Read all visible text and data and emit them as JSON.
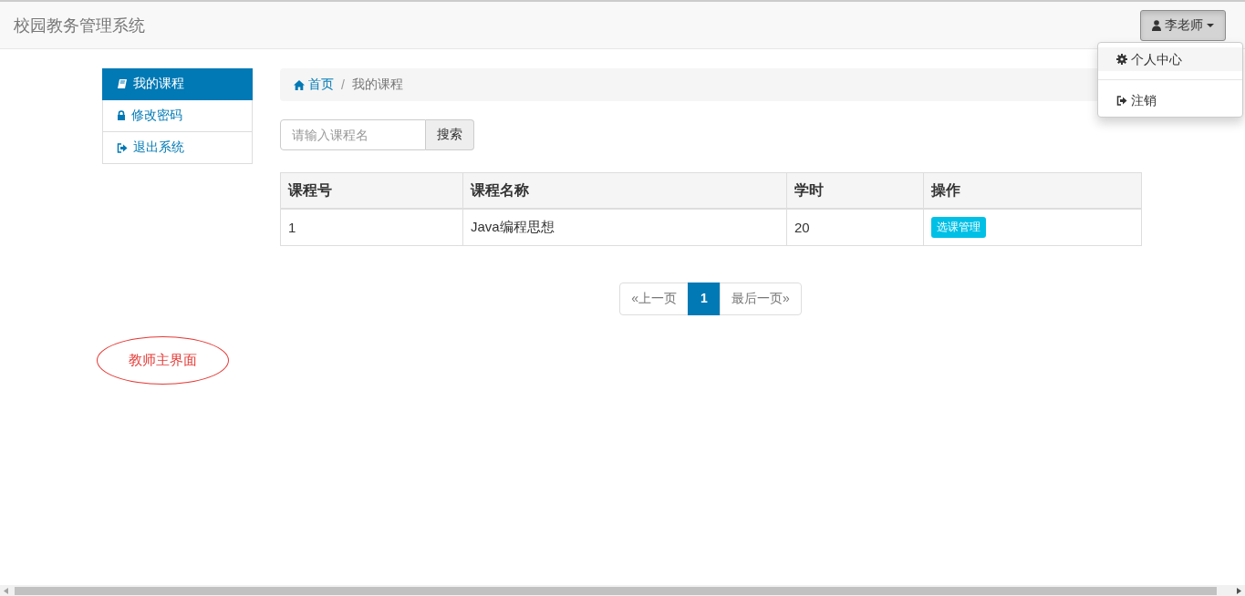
{
  "navbar": {
    "brand": "校园教务管理系统",
    "user_menu": {
      "label": "李老师",
      "expanded": true,
      "items": [
        {
          "kind": "settings",
          "label": "个人中心",
          "selected": true
        },
        {
          "kind": "logout",
          "label": "注销",
          "selected": false
        }
      ]
    }
  },
  "sidebar": {
    "items": [
      {
        "kind": "book",
        "label": "我的课程",
        "selected": true
      },
      {
        "kind": "lock",
        "label": "修改密码",
        "selected": false
      },
      {
        "kind": "logout",
        "label": "退出系统",
        "selected": false
      }
    ]
  },
  "breadcrumb": [
    {
      "kind": "home",
      "label": "首页"
    },
    {
      "kind": "separator",
      "label": "/"
    },
    {
      "kind": "current",
      "label": "我的课程"
    }
  ],
  "search": {
    "placeholder": "请输入课程名",
    "button": "搜索"
  },
  "table": {
    "columns": [
      "课程号",
      "课程名称",
      "学时",
      "操作"
    ],
    "rows": [
      {
        "cells": [
          "1",
          "Java编程思想",
          "20"
        ],
        "action": "选课管理"
      }
    ]
  },
  "pagination": [
    {
      "label": "«上一页",
      "selected": false
    },
    {
      "label": "1",
      "selected": true
    },
    {
      "label": "最后一页»",
      "selected": false
    }
  ],
  "annotation": "教师主界面"
}
